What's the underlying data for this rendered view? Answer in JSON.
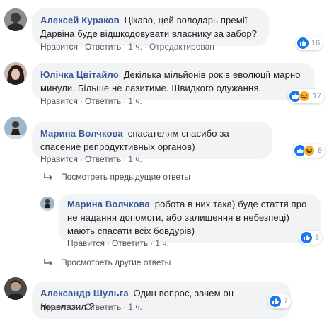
{
  "actions": {
    "like": "Нравится",
    "reply": "Ответить",
    "edited": "Отредактирован"
  },
  "comments": [
    {
      "author": "Алексей Кураков",
      "text": "Цікаво, цей володарь премії Дарвіна буде відшкодовувати власнику за забор?",
      "time": "1 ч.",
      "reactions": "16"
    },
    {
      "author": "Юлічка Цвітайло",
      "text": "Декілька мільйонів років еволюції марно минули. Більше не лазитиме. Швидкого одужання.",
      "time": "1 ч.",
      "reactions": "17"
    },
    {
      "author": "Марина Волчкова",
      "text": "спасателям спасибо за спасение репродуктивных органов)",
      "time": "1 ч.",
      "reactions": "9"
    },
    {
      "author": "Марина Волчкова",
      "text": "робота в них така) буде стаття про не надання допомоги, або залишення в небезпеці) мають спасати всіх бовдурів)",
      "time": "1 ч.",
      "reactions": "3"
    },
    {
      "author": "Александр Шульга",
      "text": "Один вопрос, зачем он перелазил ?",
      "time": "1 ч.",
      "reactions": "7"
    }
  ],
  "links": {
    "previous_replies": "Посмотреть предыдущие ответы",
    "other_replies": "Просмотреть другие ответы"
  }
}
